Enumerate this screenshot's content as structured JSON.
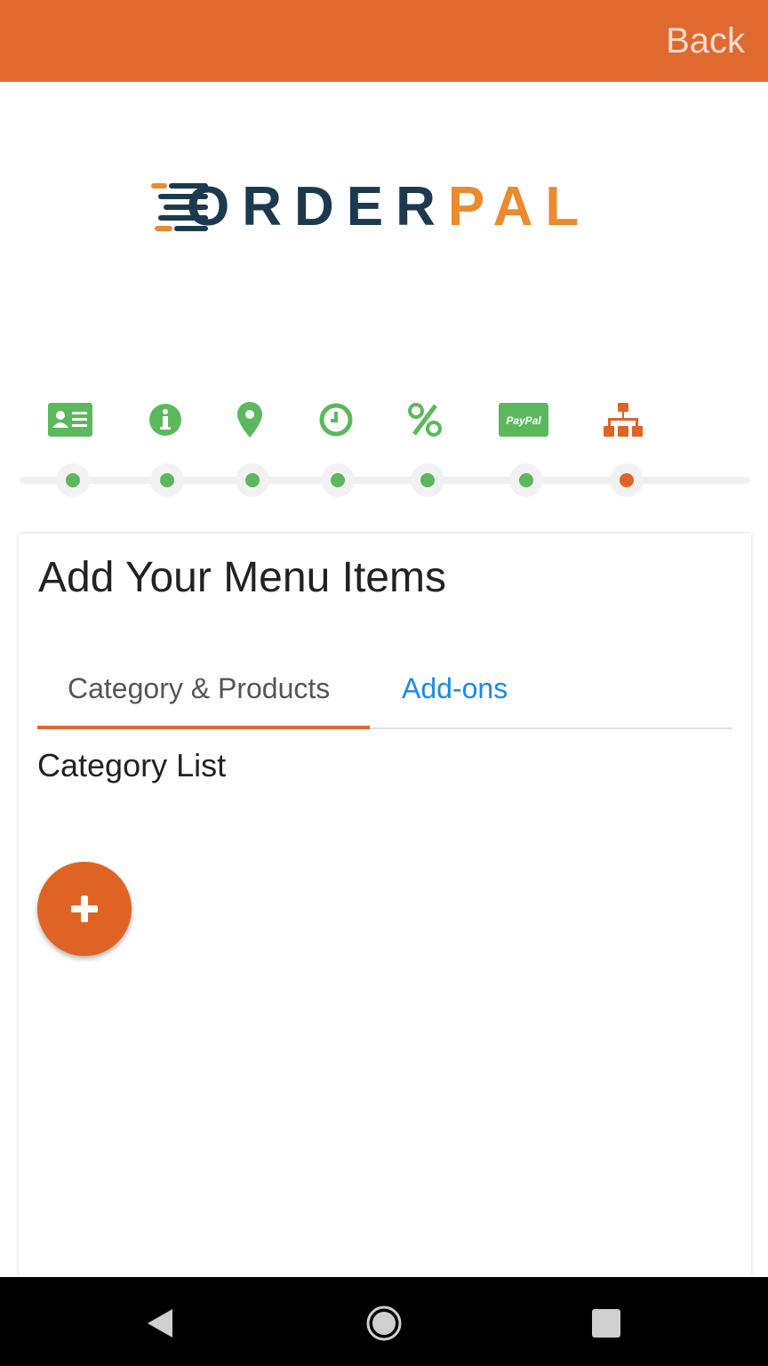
{
  "header": {
    "back_label": "Back"
  },
  "logo": {
    "text_dark": "ORDER",
    "text_accent": "PAL"
  },
  "steps": [
    {
      "icon": "id-card-icon",
      "status": "complete"
    },
    {
      "icon": "info-icon",
      "status": "complete"
    },
    {
      "icon": "location-pin-icon",
      "status": "complete"
    },
    {
      "icon": "clock-icon",
      "status": "complete"
    },
    {
      "icon": "percent-icon",
      "status": "complete"
    },
    {
      "icon": "paypal-icon",
      "label": "PayPal",
      "status": "complete"
    },
    {
      "icon": "sitemap-icon",
      "status": "current"
    }
  ],
  "card": {
    "title": "Add Your Menu Items",
    "tabs": [
      {
        "label": "Category & Products",
        "active": true
      },
      {
        "label": "Add-ons",
        "active": false
      }
    ],
    "section_title": "Category List"
  },
  "fab": {
    "icon": "plus-icon"
  },
  "nav": {
    "back": "nav-back-icon",
    "home": "nav-home-icon",
    "recents": "nav-recents-icon"
  },
  "colors": {
    "header": "#e06930",
    "step_complete": "#5cb85c",
    "step_current": "#e06326",
    "tab_active_underline": "#e06930",
    "tab_inactive_text": "#1e88e5",
    "logo_dark": "#1b3a4d",
    "logo_accent": "#ec8a2e"
  }
}
